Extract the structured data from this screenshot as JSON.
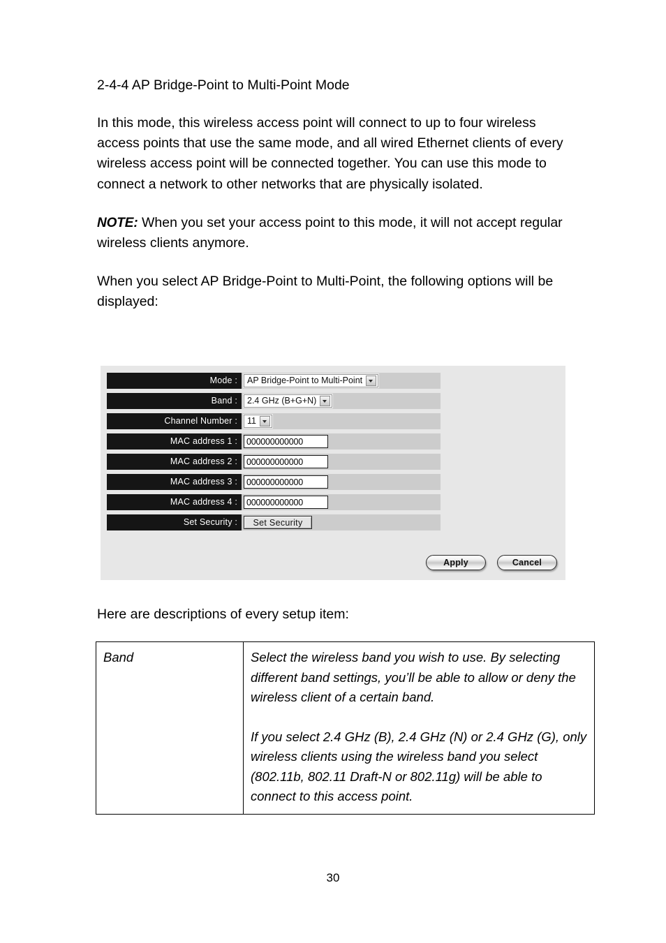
{
  "document": {
    "heading": "2-4-4 AP Bridge-Point to Multi-Point Mode",
    "intro_paragraph": "In this mode, this wireless access point will connect to up to four wireless access points that use the same mode, and all wired Ethernet clients of every wireless access point will be connected together. You can use this mode to connect a network to other networks that are physically isolated.",
    "note_label": "NOTE:",
    "note_text": " When you set your access point to this mode, it will not accept regular wireless clients anymore.",
    "options_paragraph": "When you select AP Bridge-Point to Multi-Point, the following options will be displayed:",
    "descriptions_intro": "Here are descriptions of every setup item:",
    "page_number": "30"
  },
  "screenshot": {
    "rows": [
      {
        "label": "Mode :",
        "control": "select",
        "value": "AP Bridge-Point to Multi-Point"
      },
      {
        "label": "Band :",
        "control": "select",
        "value": "2.4 GHz (B+G+N)"
      },
      {
        "label": "Channel Number :",
        "control": "select",
        "value": "11"
      },
      {
        "label": "MAC address 1 :",
        "control": "text",
        "value": "000000000000"
      },
      {
        "label": "MAC address 2 :",
        "control": "text",
        "value": "000000000000"
      },
      {
        "label": "MAC address 3 :",
        "control": "text",
        "value": "000000000000"
      },
      {
        "label": "MAC address 4 :",
        "control": "text",
        "value": "000000000000"
      },
      {
        "label": "Set Security :",
        "control": "button",
        "value": "Set Security"
      }
    ],
    "apply_label": "Apply",
    "cancel_label": "Cancel",
    "colors": {
      "panel_background": "#e7e7e7",
      "label_background": "#151515",
      "label_text": "#ffffff",
      "row_background": "#cccccc"
    }
  },
  "description_table": {
    "rows": [
      {
        "term": "Band",
        "paragraphs": [
          "Select the wireless band you wish to use. By selecting different band settings, you’ll be able to allow or deny the wireless client of a certain band.",
          "If you select 2.4 GHz (B), 2.4 GHz (N) or 2.4 GHz (G), only wireless clients using the wireless band you select (802.11b, 802.11 Draft-N or 802.11g) will be able to connect to this access point."
        ]
      }
    ]
  }
}
